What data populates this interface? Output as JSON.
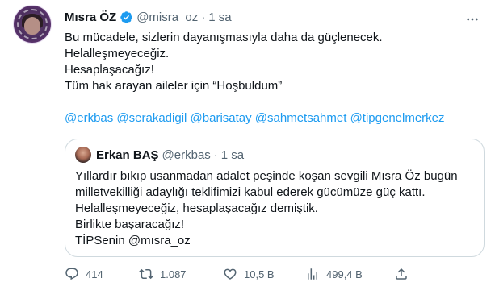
{
  "tweet": {
    "author_name": "Mısra ÖZ",
    "author_handle": "@misra_oz",
    "separator": "·",
    "time": "1 sa",
    "lines": [
      "Bu mücadele, sizlerin dayanışmasıyla daha da güçlenecek.",
      "Helalleşmeyeceğiz.",
      "Hesaplaşacağız!",
      "Tüm hak arayan aileler için “Hoşbuldum”"
    ],
    "mentions": [
      "@erkbas",
      "@serakadigil",
      "@barisatay",
      "@sahmetsahmet",
      "@tipgenelmerkez"
    ]
  },
  "quote": {
    "author_name": "Erkan BAŞ",
    "author_handle": "@erkbas",
    "separator": "·",
    "time": "1 sa",
    "lines": [
      "Yıllardır bıkıp usanmadan adalet peşinde koşan sevgili Mısra Öz bugün",
      "milletvekilliği adaylığı teklifimizi kabul ederek gücümüze güç kattı.",
      "Helalleşmeyeceğiz, hesaplaşacağız demiştik.",
      "Birlikte başaracağız!",
      "TİPSenin @mısra_oz"
    ]
  },
  "actions": {
    "reply_count": "414",
    "retweet_count": "1.087",
    "like_count": "10,5 B",
    "view_count": "499,4 B"
  },
  "colors": {
    "accent": "#1d9bf0",
    "text": "#0f1419",
    "muted": "#536471",
    "border": "#cfd9de"
  },
  "icons": [
    "more-icon",
    "verified-badge-icon",
    "reply-icon",
    "retweet-icon",
    "like-icon",
    "views-icon",
    "share-icon"
  ]
}
